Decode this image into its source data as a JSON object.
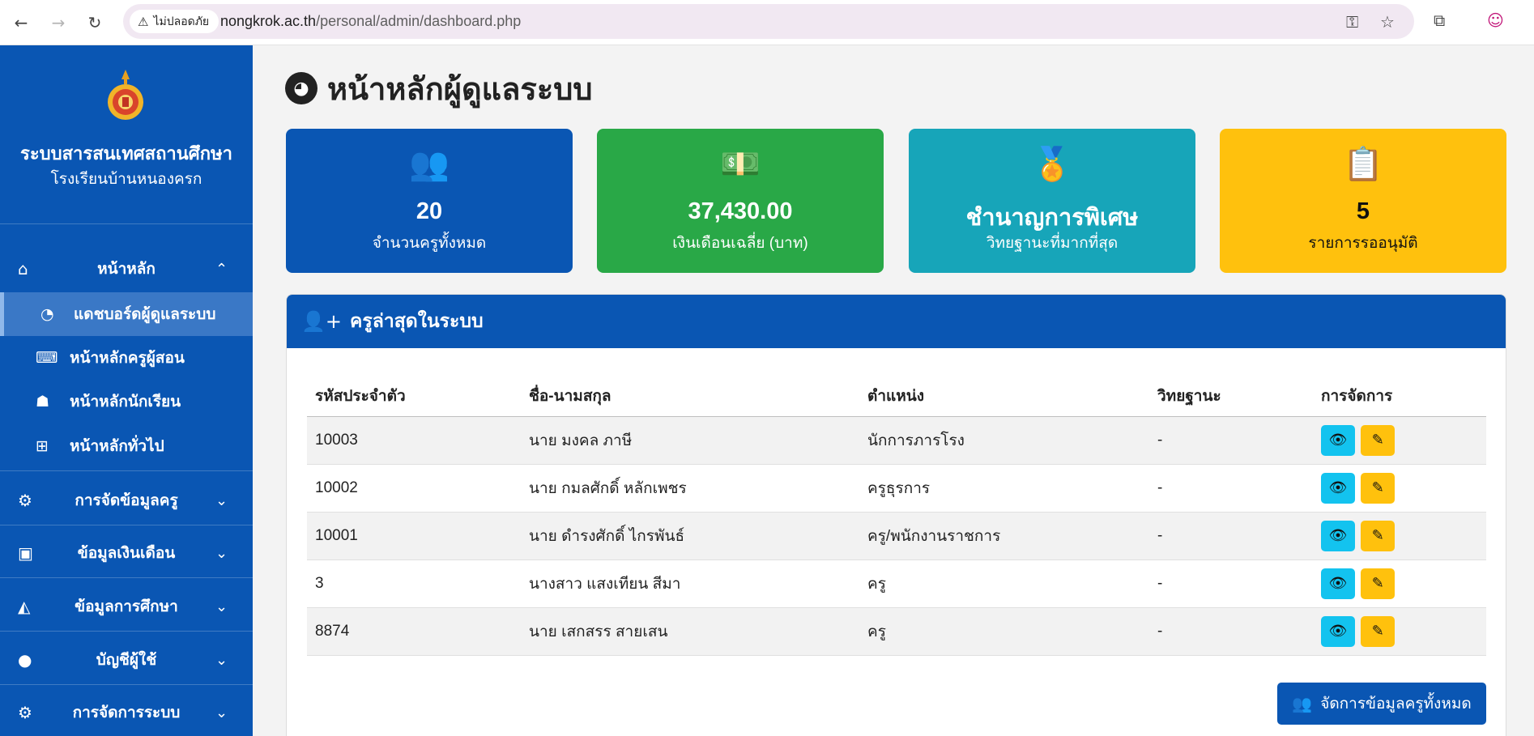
{
  "browser": {
    "back_icon": "←",
    "forward_icon": "→",
    "reload_icon": "↻",
    "security_warning": "ไม่ปลอดภัย",
    "url_host": "nongkrok.ac.th",
    "url_path": "/personal/admin/dashboard.php",
    "key_icon": "⚿",
    "star_icon": "☆",
    "extensions_icon": "⧉",
    "profile_icon": "☺"
  },
  "sidebar": {
    "title": "ระบบสารสนเทศสถานศึกษา",
    "school": "โรงเรียนบ้านหนองครก",
    "home_section": {
      "icon": "⌂",
      "label": "หน้าหลัก",
      "chevron": "⌃"
    },
    "sub_items": [
      {
        "icon": "◔",
        "label": "แดชบอร์ดผู้ดูแลระบบ",
        "active": true
      },
      {
        "icon": "⌨",
        "label": "หน้าหลักครูผู้สอน"
      },
      {
        "icon": "☗",
        "label": "หน้าหลักนักเรียน"
      },
      {
        "icon": "⊞",
        "label": "หน้าหลักทั่วไป"
      }
    ],
    "sections": [
      {
        "icon": "⚙",
        "label": "การจัดข้อมูลครู",
        "chevron": "⌄"
      },
      {
        "icon": "▣",
        "label": "ข้อมูลเงินเดือน",
        "chevron": "⌄"
      },
      {
        "icon": "◭",
        "label": "ข้อมูลการศึกษา",
        "chevron": "⌄"
      },
      {
        "icon": "●",
        "label": "บัญชีผู้ใช้",
        "chevron": "⌄"
      },
      {
        "icon": "⚙",
        "label": "การจัดการระบบ",
        "chevron": "⌄"
      }
    ]
  },
  "main": {
    "title_icon": "◕",
    "title": "หน้าหลักผู้ดูแลระบบ",
    "stats": [
      {
        "icon": "👥",
        "value": "20",
        "label": "จำนวนครูทั้งหมด"
      },
      {
        "icon": "💵",
        "value": "37,430.00",
        "label": "เงินเดือนเฉลี่ย (บาท)"
      },
      {
        "icon": "🏅",
        "value": "ชำนาญการพิเศษ",
        "label": "วิทยฐานะที่มากที่สุด"
      },
      {
        "icon": "📋",
        "value": "5",
        "label": "รายการรออนุมัติ"
      }
    ],
    "recent_panel": {
      "icon": "👤+",
      "title": "ครูล่าสุดในระบบ",
      "columns": [
        "รหัสประจำตัว",
        "ชื่อ-นามสกุล",
        "ตำแหน่ง",
        "วิทยฐานะ",
        "การจัดการ"
      ],
      "rows": [
        {
          "id": "10003",
          "name": "นาย มงคล ภาษี",
          "position": "นักการภารโรง",
          "rank": "-"
        },
        {
          "id": "10002",
          "name": "นาย กมลศักดิ์ หลักเพชร",
          "position": "ครูธุรการ",
          "rank": "-"
        },
        {
          "id": "10001",
          "name": "นาย ดำรงศักดิ์ ไกรพันธ์",
          "position": "ครู/พนักงานราชการ",
          "rank": "-"
        },
        {
          "id": "3",
          "name": "นางสาว แสงเทียน สีมา",
          "position": "ครู",
          "rank": "-"
        },
        {
          "id": "8874",
          "name": "นาย เสกสรร สายเสน",
          "position": "ครู",
          "rank": "-"
        }
      ],
      "view_icon": "👁",
      "edit_icon": "✎",
      "manage_icon": "👥",
      "manage_label": "จัดการข้อมูลครูทั้งหมด"
    }
  }
}
